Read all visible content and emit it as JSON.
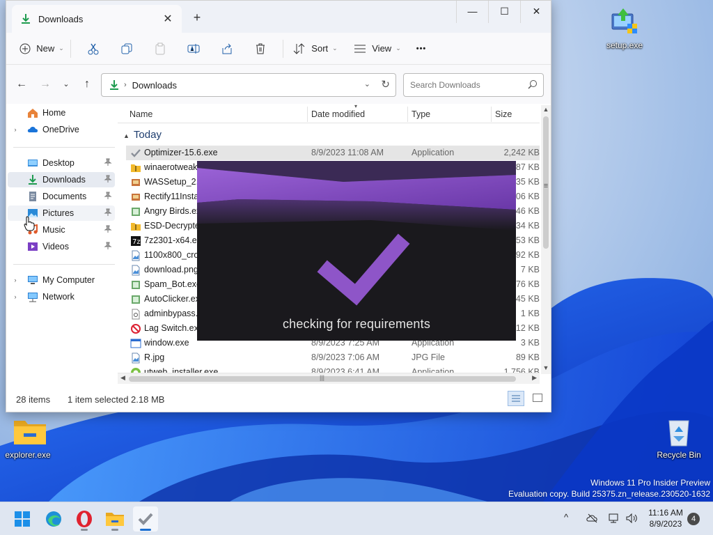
{
  "desktop": {
    "icons": [
      {
        "label": "setup.exe"
      },
      {
        "label": "explorer.exe"
      },
      {
        "label": "Recycle Bin"
      }
    ],
    "watermark_line1": "Windows 11 Pro Insider Preview",
    "watermark_line2": "Evaluation copy. Build 25375.zn_release.230520-1632"
  },
  "window": {
    "tab_title": "Downloads",
    "tab_close": "✕",
    "new_tab": "+",
    "controls": {
      "minimize": "—",
      "maximize": "☐",
      "close": "✕"
    },
    "toolbar": {
      "new_label": "New",
      "sort_label": "Sort",
      "view_label": "View",
      "more_label": "•••"
    },
    "address": {
      "breadcrumb": "Downloads",
      "search_placeholder": "Search Downloads"
    },
    "sidebar": [
      {
        "label": "Home",
        "icon": "home-icon"
      },
      {
        "label": "OneDrive",
        "icon": "cloud-icon"
      },
      {
        "label": "Desktop",
        "icon": "desktop-icon"
      },
      {
        "label": "Downloads",
        "icon": "download-icon"
      },
      {
        "label": "Documents",
        "icon": "documents-icon"
      },
      {
        "label": "Pictures",
        "icon": "pictures-icon"
      },
      {
        "label": "Music",
        "icon": "music-icon"
      },
      {
        "label": "Videos",
        "icon": "videos-icon"
      },
      {
        "label": "My Computer",
        "icon": "computer-icon"
      },
      {
        "label": "Network",
        "icon": "network-icon"
      }
    ],
    "columns": {
      "name": "Name",
      "date": "Date modified",
      "type": "Type",
      "size": "Size"
    },
    "group": "Today",
    "files": [
      {
        "name": "Optimizer-15.6.exe",
        "date": "8/9/2023 11:08 AM",
        "type": "Application",
        "size": "2,242 KB",
        "icon": "check-icon"
      },
      {
        "name": "winaerotweake",
        "date": "",
        "type": "",
        "size": "787 KB",
        "icon": "zip-folder-icon"
      },
      {
        "name": "WASSetup_2.0",
        "date": "",
        "type": "",
        "size": "535 KB",
        "icon": "installer-icon"
      },
      {
        "name": "Rectify11Instal",
        "date": "",
        "type": "",
        "size": "606 KB",
        "icon": "installer-icon"
      },
      {
        "name": "Angry Birds.ex",
        "date": "",
        "type": "",
        "size": "946 KB",
        "icon": "app-icon"
      },
      {
        "name": "ESD-Decrypter",
        "date": "",
        "type": "",
        "size": "834 KB",
        "icon": "zip-folder-icon"
      },
      {
        "name": "7z2301-x64.exe",
        "date": "",
        "type": "",
        "size": "553 KB",
        "icon": "7zip-icon"
      },
      {
        "name": "1100x800_crop",
        "date": "",
        "type": "",
        "size": "192 KB",
        "icon": "image-file-icon"
      },
      {
        "name": "download.png",
        "date": "",
        "type": "",
        "size": "7 KB",
        "icon": "image-file-icon"
      },
      {
        "name": "Spam_Bot.exe",
        "date": "",
        "type": "",
        "size": "76 KB",
        "icon": "app-icon"
      },
      {
        "name": "AutoClicker.ex",
        "date": "",
        "type": "",
        "size": "845 KB",
        "icon": "app-icon"
      },
      {
        "name": "adminbypass.c",
        "date": "",
        "type": "",
        "size": "1 KB",
        "icon": "gear-file-icon"
      },
      {
        "name": "Lag Switch.exe",
        "date": "",
        "type": "",
        "size": "312 KB",
        "icon": "no-sign-icon"
      },
      {
        "name": "window.exe",
        "date": "8/9/2023 7:25 AM",
        "type": "Application",
        "size": "3 KB",
        "icon": "window-app-icon"
      },
      {
        "name": "R.jpg",
        "date": "8/9/2023 7:06 AM",
        "type": "JPG File",
        "size": "89 KB",
        "icon": "image-file-icon"
      },
      {
        "name": "utweb_installer.exe",
        "date": "8/9/2023 6:41 AM",
        "type": "Application",
        "size": "1,756 KB",
        "icon": "utorrent-icon"
      }
    ],
    "status": {
      "count": "28 items",
      "selection": "1 item selected  2.18 MB"
    }
  },
  "popup": {
    "message": "checking for requirements"
  },
  "taskbar": {
    "clock_time": "11:16 AM",
    "clock_date": "8/9/2023",
    "notification_count": "4",
    "tray_overflow": "^"
  },
  "colors": {
    "accent": "#1c6fd2",
    "popup_purple": "#8e55c8",
    "popup_bg": "#1a191d"
  }
}
